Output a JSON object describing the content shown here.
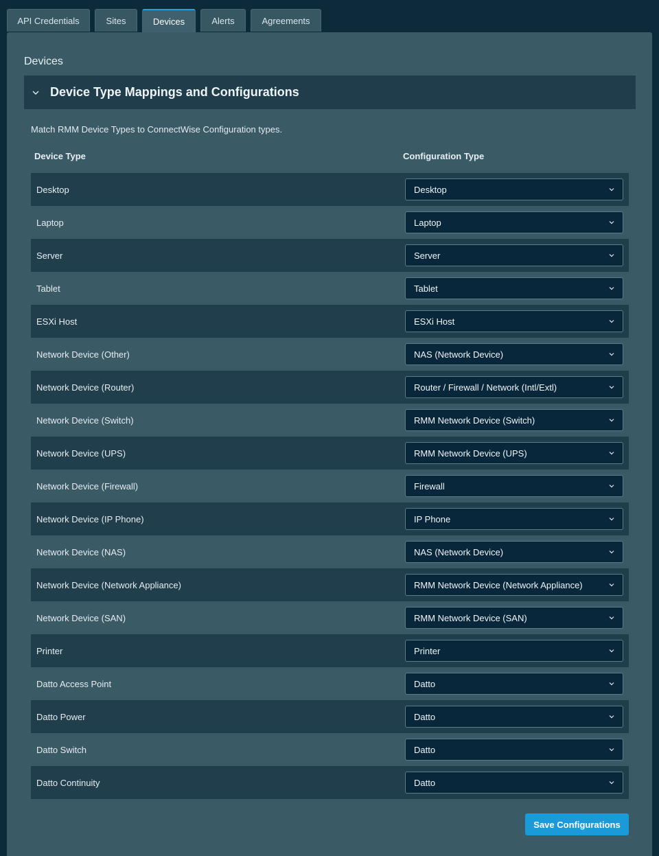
{
  "tabs": [
    {
      "label": "API Credentials",
      "active": false
    },
    {
      "label": "Sites",
      "active": false
    },
    {
      "label": "Devices",
      "active": true
    },
    {
      "label": "Alerts",
      "active": false
    },
    {
      "label": "Agreements",
      "active": false
    }
  ],
  "section": {
    "title": "Devices",
    "accordion_title": "Device Type Mappings and Configurations",
    "accordion_icon": "chevron-down-icon",
    "description": "Match RMM Device Types to ConnectWise Configuration types."
  },
  "table": {
    "col_device_type": "Device Type",
    "col_config_type": "Configuration Type",
    "rows": [
      {
        "device": "Desktop",
        "config": "Desktop"
      },
      {
        "device": "Laptop",
        "config": "Laptop"
      },
      {
        "device": "Server",
        "config": "Server"
      },
      {
        "device": "Tablet",
        "config": "Tablet"
      },
      {
        "device": "ESXi Host",
        "config": "ESXi Host"
      },
      {
        "device": "Network Device (Other)",
        "config": "NAS (Network Device)"
      },
      {
        "device": "Network Device (Router)",
        "config": "Router / Firewall / Network (Intl/Extl)"
      },
      {
        "device": "Network Device (Switch)",
        "config": "RMM Network Device (Switch)"
      },
      {
        "device": "Network Device (UPS)",
        "config": "RMM Network Device (UPS)"
      },
      {
        "device": "Network Device (Firewall)",
        "config": "Firewall"
      },
      {
        "device": "Network Device (IP Phone)",
        "config": "IP Phone"
      },
      {
        "device": "Network Device (NAS)",
        "config": "NAS (Network Device)"
      },
      {
        "device": "Network Device (Network Appliance)",
        "config": "RMM Network Device (Network Appliance)"
      },
      {
        "device": "Network Device (SAN)",
        "config": "RMM Network Device (SAN)"
      },
      {
        "device": "Printer",
        "config": "Printer"
      },
      {
        "device": "Datto Access Point",
        "config": "Datto"
      },
      {
        "device": "Datto Power",
        "config": "Datto"
      },
      {
        "device": "Datto Switch",
        "config": "Datto"
      },
      {
        "device": "Datto Continuity",
        "config": "Datto"
      }
    ]
  },
  "save_button": {
    "label": "Save Configurations"
  },
  "colors": {
    "background": "#0d2a3a",
    "panel": "#3a5a66",
    "row_dark": "#213e4c",
    "select_bg": "#09273a",
    "accent": "#1a9ad9"
  }
}
